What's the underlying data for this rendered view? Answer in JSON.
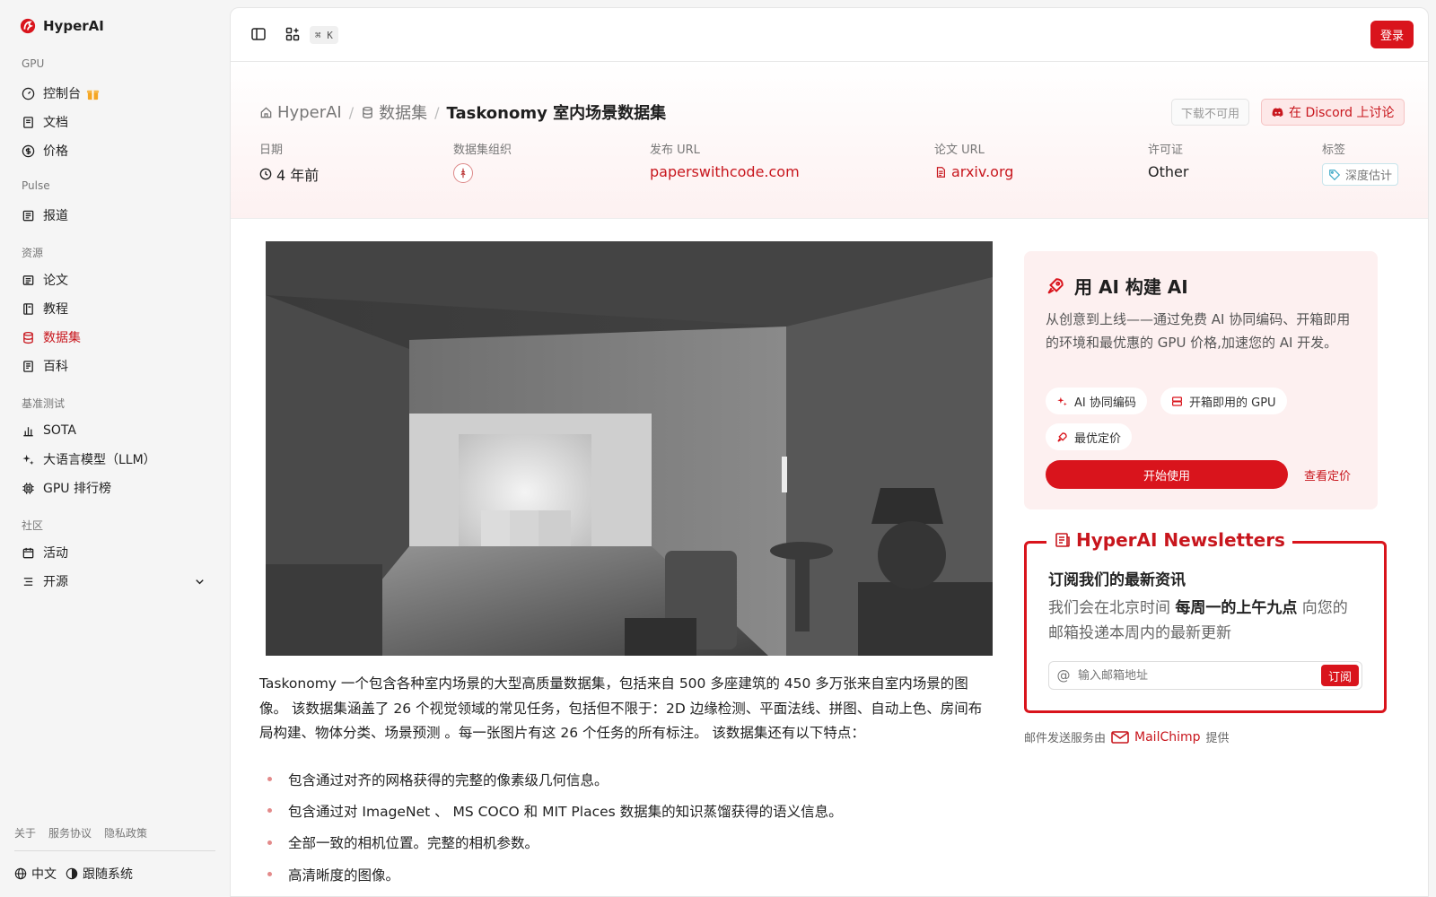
{
  "app": {
    "name": "HyperAI"
  },
  "sidebar": {
    "sections": [
      {
        "title": "GPU",
        "items": [
          {
            "label": "控制台"
          },
          {
            "label": "文档"
          },
          {
            "label": "价格"
          }
        ]
      },
      {
        "title": "Pulse",
        "items": [
          {
            "label": "报道"
          }
        ]
      },
      {
        "title": "资源",
        "items": [
          {
            "label": "论文"
          },
          {
            "label": "教程"
          },
          {
            "label": "数据集",
            "active": true
          },
          {
            "label": "百科"
          }
        ]
      },
      {
        "title": "基准测试",
        "items": [
          {
            "label": "SOTA"
          },
          {
            "label": "大语言模型（LLM）"
          },
          {
            "label": "GPU 排行榜"
          }
        ]
      },
      {
        "title": "社区",
        "items": [
          {
            "label": "活动"
          },
          {
            "label": "开源"
          }
        ]
      }
    ],
    "footer_links": [
      "关于",
      "服务协议",
      "隐私政策"
    ],
    "language": "中文",
    "theme": "跟随系统"
  },
  "topbar": {
    "shortcut": "⌘ K",
    "login_label": "登录"
  },
  "breadcrumb": {
    "home": "HyperAI",
    "datasets": "数据集",
    "current": "Taskonomy 室内场景数据集"
  },
  "actions": {
    "download": "下载不可用",
    "discord": "在 Discord 上讨论"
  },
  "meta": {
    "date": {
      "label": "日期",
      "value": "4 年前"
    },
    "org": {
      "label": "数据集组织"
    },
    "publish_url": {
      "label": "发布 URL",
      "value": "paperswithcode.com"
    },
    "paper_url": {
      "label": "论文 URL",
      "value": "arxiv.org"
    },
    "license": {
      "label": "许可证",
      "value": "Other"
    },
    "tags": {
      "label": "标签",
      "value": "深度估计"
    }
  },
  "description": "Taskonomy 一个包含各种室内场景的大型高质量数据集，包括来自 500 多座建筑的 450 多万张来自室内场景的图像。 该数据集涵盖了 26 个视觉领域的常见任务，包括但不限于：2D 边缘检测、平面法线、拼图、自动上色、房间布局构建、物体分类、场景预测 。每一张图片有这 26 个任务的所有标注。 该数据集还有以下特点：",
  "features": [
    "包含通过对齐的网格获得的完整的像素级几何信息。",
    "包含通过对 ImageNet 、 MS COCO 和 MIT Places 数据集的知识蒸馏获得的语义信息。",
    "全部一致的相机位置。完整的相机参数。",
    "高清晰度的图像。"
  ],
  "ai_card": {
    "title": "用 AI 构建 AI",
    "body": "从创意到上线——通过免费 AI 协同编码、开箱即用的环境和最优惠的 GPU 价格,加速您的 AI 开发。",
    "chips": [
      "AI 协同编码",
      "开箱即用的 GPU",
      "最优定价"
    ],
    "cta": "开始使用",
    "link": "查看定价"
  },
  "newsletter": {
    "title": "HyperAI Newsletters",
    "heading": "订阅我们的最新资讯",
    "text_pre": "我们会在北京时间 ",
    "text_bold": "每周一的上午九点",
    "text_post": " 向您的邮箱投递本周内的最新更新",
    "placeholder": "输入邮箱地址",
    "submit": "订阅",
    "provider_pre": "邮件发送服务由",
    "provider": "MailChimp",
    "provider_post": "提供"
  },
  "colors": {
    "accent": "#d9141c",
    "link": "#c8161d"
  }
}
